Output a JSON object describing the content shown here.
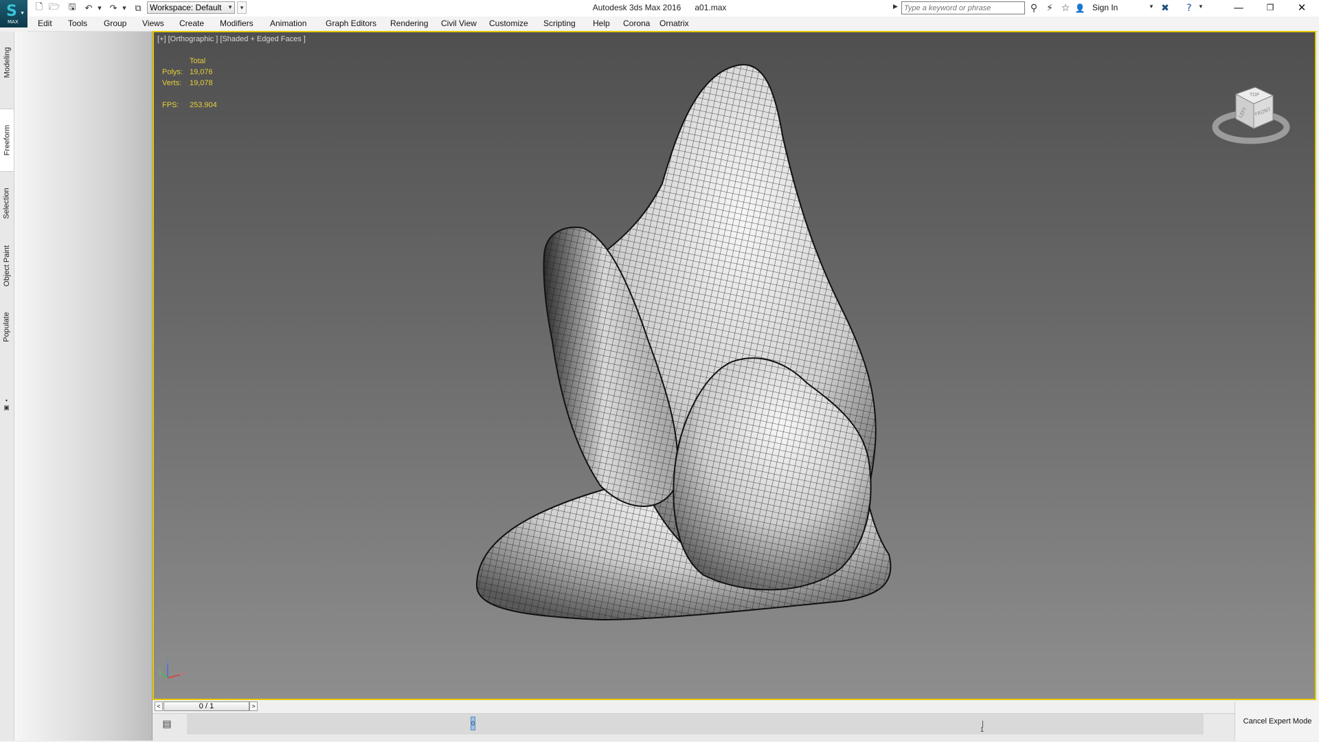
{
  "titlebar": {
    "window_title": "Autodesk 3ds Max 2016      a01.max",
    "app_logo_text": "MAX",
    "workspace_label": "Workspace: Default",
    "search_placeholder": "Type a keyword or phrase",
    "signin_label": "Sign In",
    "quick_access_icons": [
      "new-file-icon",
      "open-file-icon",
      "save-icon",
      "undo-icon",
      "undo-dropdown-icon",
      "redo-icon",
      "redo-dropdown-icon",
      "project-folder-icon"
    ],
    "toolbar_icons": [
      "binoculars-icon",
      "communication-center-icon",
      "favorites-star-icon",
      "user-icon",
      "exchange-apps-icon",
      "help-icon"
    ],
    "window_controls": [
      "minimize-icon",
      "restore-icon",
      "close-icon"
    ]
  },
  "menubar": {
    "items": [
      "Edit",
      "Tools",
      "Group",
      "Views",
      "Create",
      "Modifiers",
      "Animation",
      "Graph Editors",
      "Rendering",
      "Civil View",
      "Customize",
      "Scripting",
      "Help",
      "Corona",
      "Ornatrix"
    ]
  },
  "ribbon_tabs": {
    "items": [
      "Modeling",
      "Freeform",
      "Selection",
      "Object Paint",
      "Populate"
    ],
    "active": "Freeform"
  },
  "viewport": {
    "label": "[+] [Orthographic ] [Shaded + Edged Faces ]",
    "stats": {
      "header": "Total",
      "polys_label": "Polys:",
      "polys_value": "19,076",
      "verts_label": "Verts:",
      "verts_value": "19,078",
      "fps_label": "FPS:",
      "fps_value": "253.904"
    },
    "viewcube": {
      "top": "TOP",
      "left": "LEFT",
      "front": "FRONT"
    },
    "axes": {
      "x": "x",
      "y": "y",
      "z": "z"
    },
    "colors": {
      "border": "#e6c800",
      "stats_text": "#e5cf3c"
    }
  },
  "timeslider": {
    "prev_label": "<",
    "position_label": "0 / 1",
    "next_label": ">"
  },
  "trackbar": {
    "key_label": "0",
    "end_label": "1"
  },
  "status": {
    "cancel_expert_mode": "Cancel Expert Mode"
  }
}
